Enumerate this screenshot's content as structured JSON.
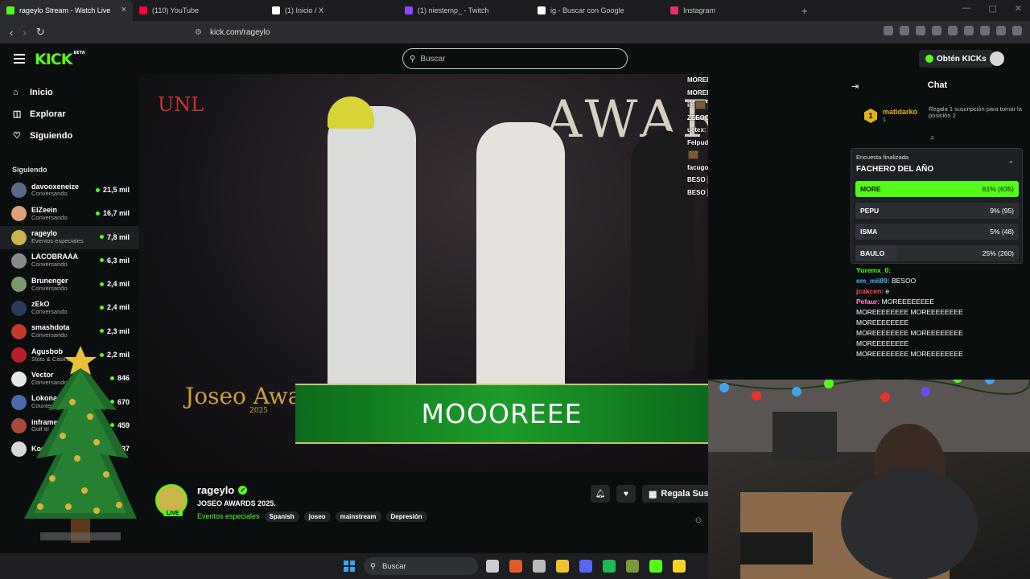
{
  "browser": {
    "tabs": [
      {
        "label": "rageylo Stream - Watch Live",
        "color": "#53fc18",
        "active": true
      },
      {
        "label": "(110) YouTube",
        "color": "#ff0033",
        "active": false
      },
      {
        "label": "(1) Inicio / X",
        "color": "#ffffff",
        "active": false
      },
      {
        "label": "(1) niestemp_ - Twitch",
        "color": "#9146ff",
        "active": false
      },
      {
        "label": "ig - Buscar con Google",
        "color": "#ffffff",
        "active": false
      },
      {
        "label": "Instagram",
        "color": "#e1306c",
        "active": false
      }
    ],
    "url": "kick.com/rageylo"
  },
  "header": {
    "logo": "KICK",
    "logo_beta": "BETA",
    "search_placeholder": "Buscar",
    "get_kicks": "Obtén KICKs"
  },
  "sidebar": {
    "nav": [
      {
        "label": "Inicio",
        "icon": "home-icon"
      },
      {
        "label": "Explorar",
        "icon": "compass-icon"
      },
      {
        "label": "Siguiendo",
        "icon": "heart-icon"
      }
    ],
    "following_title": "Siguiendo",
    "following": [
      {
        "name": "davooxeneize",
        "category": "Conversando",
        "viewers": "21,5 mil",
        "color": "#5a6a8a"
      },
      {
        "name": "ElZeein",
        "category": "Conversando",
        "viewers": "16,7 mil",
        "color": "#d9a07a"
      },
      {
        "name": "rageylo",
        "category": "Eventos especiales",
        "viewers": "7,8 mil",
        "color": "#c9b54a",
        "active": true
      },
      {
        "name": "LACOBRAAA",
        "category": "Conversando",
        "viewers": "6,3 mil",
        "color": "#8a8a8a"
      },
      {
        "name": "Brunenger",
        "category": "Conversando",
        "viewers": "2,4 mil",
        "color": "#7a9a6a"
      },
      {
        "name": "zEkO",
        "category": "Conversando",
        "viewers": "2,4 mil",
        "color": "#2a3a5a"
      },
      {
        "name": "smashdota",
        "category": "Conversando",
        "viewers": "2,3 mil",
        "color": "#c23a2a"
      },
      {
        "name": "Agusbob",
        "category": "Slots & Casino",
        "viewers": "2,2 mil",
        "color": "#b8202a"
      },
      {
        "name": "Vector",
        "category": "Conversando",
        "viewers": "846",
        "color": "#e8e8e8"
      },
      {
        "name": "Lokonaz",
        "category": "Counter-Strike",
        "viewers": "670",
        "color": "#4a6aa8"
      },
      {
        "name": "inframe",
        "category": "Golf It!",
        "viewers": "459",
        "color": "#a84a3a"
      },
      {
        "name": "Kodo",
        "category": "",
        "viewers": "37",
        "color": "#d8d8d8"
      }
    ]
  },
  "video": {
    "banner_text": "MOOOREEE",
    "stage_text": "AWARDS",
    "corner_logo": "UNL",
    "event_logo": "Joseo Awards",
    "event_year": "2025",
    "overlay_chat": [
      "MOREEEEEEEE",
      "MOREEEEEEEE",
      "im",
      "ZEEOO",
      "uetex:",
      "Felpudo: EPOCA MEDIEVAL LE CLAVO",
      "facugodd: BESO",
      "BESO",
      "BESO"
    ]
  },
  "streamer": {
    "name": "rageylo",
    "title": "JOSEO AWARDS 2025.",
    "category": "Eventos especiales",
    "tags": [
      "Spanish",
      "joseo",
      "mainstream",
      "Depresión"
    ],
    "live": "LIVE",
    "gift_label": "Regala Susc"
  },
  "chat": {
    "title": "Chat",
    "pinned_rank": "1",
    "pinned_user": "matidarko",
    "pinned_sub": "1",
    "pinned_note": "Regala 1 suscripción para tomar la posición 2",
    "poll": {
      "status": "Encuesta finalizada",
      "question": "FACHERO DEL AÑO",
      "options": [
        {
          "label": "MORE",
          "result": "61% (635)",
          "percent": 61,
          "winner": true
        },
        {
          "label": "PEPU",
          "result": "9% (95)",
          "percent": 9,
          "winner": false
        },
        {
          "label": "ISMA",
          "result": "5% (48)",
          "percent": 5,
          "winner": false
        },
        {
          "label": "BAULO",
          "result": "25% (260)",
          "percent": 25,
          "winner": false
        }
      ]
    },
    "messages": [
      {
        "user": "Yuremx_0:",
        "text": "",
        "color": "#53fc18"
      },
      {
        "user": "em_mii89:",
        "text": "BESOO",
        "color": "#4ab0ff"
      },
      {
        "user": "jcakcen:",
        "text": "e",
        "color": "#ff4a4a"
      },
      {
        "user": "Pefaur:",
        "text": "MOREEEEEEEE",
        "color": "#ff8ad8"
      },
      {
        "user": "",
        "text": "MOREEEEEEEE MOREEEEEEEE",
        "color": "#ffffff"
      },
      {
        "user": "",
        "text": "MOREEEEEEEE",
        "color": "#ffffff"
      },
      {
        "user": "",
        "text": "MOREEEEEEEE MOREEEEEEEE",
        "color": "#ffffff"
      },
      {
        "user": "",
        "text": "MOREEEEEEEE",
        "color": "#ffffff"
      },
      {
        "user": "",
        "text": "MOREEEEEEEE MOREEEEEEEE",
        "color": "#ffffff"
      }
    ]
  },
  "taskbar": {
    "search_placeholder": "Buscar",
    "apps": [
      "#cccccc",
      "#e05a2a",
      "#bbbbbb",
      "#f2c230",
      "#5865f2",
      "#1db954",
      "#7a9a3a",
      "#53fc18",
      "#f2d32a"
    ]
  }
}
